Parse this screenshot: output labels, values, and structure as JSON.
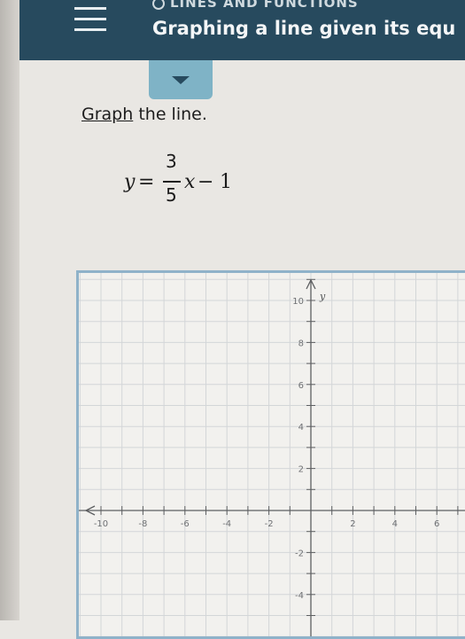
{
  "header": {
    "topic": "LINES AND FUNCTIONS",
    "title": "Graphing a line given its equ"
  },
  "instruction": {
    "link_text": "Graph",
    "rest": " the line."
  },
  "equation": {
    "lhs": "y",
    "equals": "=",
    "numerator": "3",
    "denominator": "5",
    "variable": "x",
    "operator": "−",
    "constant": "1"
  },
  "graph": {
    "y_axis_label": "y",
    "x_ticks": [
      "-10",
      "-8",
      "-6",
      "-4",
      "-2",
      "2",
      "4",
      "6"
    ],
    "y_ticks": [
      "10",
      "8",
      "6",
      "4",
      "2",
      "-2",
      "-4"
    ]
  }
}
